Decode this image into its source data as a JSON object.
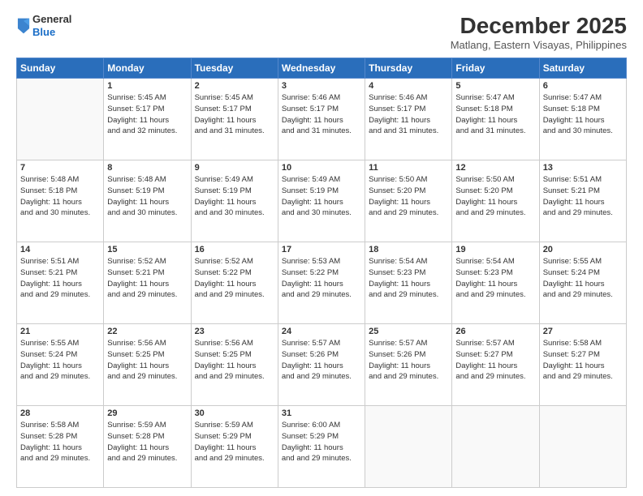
{
  "header": {
    "logo_general": "General",
    "logo_blue": "Blue",
    "month_title": "December 2025",
    "location": "Matlang, Eastern Visayas, Philippines"
  },
  "weekdays": [
    "Sunday",
    "Monday",
    "Tuesday",
    "Wednesday",
    "Thursday",
    "Friday",
    "Saturday"
  ],
  "weeks": [
    [
      {
        "day": "",
        "sunrise": "",
        "sunset": "",
        "daylight": ""
      },
      {
        "day": "1",
        "sunrise": "Sunrise: 5:45 AM",
        "sunset": "Sunset: 5:17 PM",
        "daylight": "Daylight: 11 hours and 32 minutes."
      },
      {
        "day": "2",
        "sunrise": "Sunrise: 5:45 AM",
        "sunset": "Sunset: 5:17 PM",
        "daylight": "Daylight: 11 hours and 31 minutes."
      },
      {
        "day": "3",
        "sunrise": "Sunrise: 5:46 AM",
        "sunset": "Sunset: 5:17 PM",
        "daylight": "Daylight: 11 hours and 31 minutes."
      },
      {
        "day": "4",
        "sunrise": "Sunrise: 5:46 AM",
        "sunset": "Sunset: 5:17 PM",
        "daylight": "Daylight: 11 hours and 31 minutes."
      },
      {
        "day": "5",
        "sunrise": "Sunrise: 5:47 AM",
        "sunset": "Sunset: 5:18 PM",
        "daylight": "Daylight: 11 hours and 31 minutes."
      },
      {
        "day": "6",
        "sunrise": "Sunrise: 5:47 AM",
        "sunset": "Sunset: 5:18 PM",
        "daylight": "Daylight: 11 hours and 30 minutes."
      }
    ],
    [
      {
        "day": "7",
        "sunrise": "Sunrise: 5:48 AM",
        "sunset": "Sunset: 5:18 PM",
        "daylight": "Daylight: 11 hours and 30 minutes."
      },
      {
        "day": "8",
        "sunrise": "Sunrise: 5:48 AM",
        "sunset": "Sunset: 5:19 PM",
        "daylight": "Daylight: 11 hours and 30 minutes."
      },
      {
        "day": "9",
        "sunrise": "Sunrise: 5:49 AM",
        "sunset": "Sunset: 5:19 PM",
        "daylight": "Daylight: 11 hours and 30 minutes."
      },
      {
        "day": "10",
        "sunrise": "Sunrise: 5:49 AM",
        "sunset": "Sunset: 5:19 PM",
        "daylight": "Daylight: 11 hours and 30 minutes."
      },
      {
        "day": "11",
        "sunrise": "Sunrise: 5:50 AM",
        "sunset": "Sunset: 5:20 PM",
        "daylight": "Daylight: 11 hours and 29 minutes."
      },
      {
        "day": "12",
        "sunrise": "Sunrise: 5:50 AM",
        "sunset": "Sunset: 5:20 PM",
        "daylight": "Daylight: 11 hours and 29 minutes."
      },
      {
        "day": "13",
        "sunrise": "Sunrise: 5:51 AM",
        "sunset": "Sunset: 5:21 PM",
        "daylight": "Daylight: 11 hours and 29 minutes."
      }
    ],
    [
      {
        "day": "14",
        "sunrise": "Sunrise: 5:51 AM",
        "sunset": "Sunset: 5:21 PM",
        "daylight": "Daylight: 11 hours and 29 minutes."
      },
      {
        "day": "15",
        "sunrise": "Sunrise: 5:52 AM",
        "sunset": "Sunset: 5:21 PM",
        "daylight": "Daylight: 11 hours and 29 minutes."
      },
      {
        "day": "16",
        "sunrise": "Sunrise: 5:52 AM",
        "sunset": "Sunset: 5:22 PM",
        "daylight": "Daylight: 11 hours and 29 minutes."
      },
      {
        "day": "17",
        "sunrise": "Sunrise: 5:53 AM",
        "sunset": "Sunset: 5:22 PM",
        "daylight": "Daylight: 11 hours and 29 minutes."
      },
      {
        "day": "18",
        "sunrise": "Sunrise: 5:54 AM",
        "sunset": "Sunset: 5:23 PM",
        "daylight": "Daylight: 11 hours and 29 minutes."
      },
      {
        "day": "19",
        "sunrise": "Sunrise: 5:54 AM",
        "sunset": "Sunset: 5:23 PM",
        "daylight": "Daylight: 11 hours and 29 minutes."
      },
      {
        "day": "20",
        "sunrise": "Sunrise: 5:55 AM",
        "sunset": "Sunset: 5:24 PM",
        "daylight": "Daylight: 11 hours and 29 minutes."
      }
    ],
    [
      {
        "day": "21",
        "sunrise": "Sunrise: 5:55 AM",
        "sunset": "Sunset: 5:24 PM",
        "daylight": "Daylight: 11 hours and 29 minutes."
      },
      {
        "day": "22",
        "sunrise": "Sunrise: 5:56 AM",
        "sunset": "Sunset: 5:25 PM",
        "daylight": "Daylight: 11 hours and 29 minutes."
      },
      {
        "day": "23",
        "sunrise": "Sunrise: 5:56 AM",
        "sunset": "Sunset: 5:25 PM",
        "daylight": "Daylight: 11 hours and 29 minutes."
      },
      {
        "day": "24",
        "sunrise": "Sunrise: 5:57 AM",
        "sunset": "Sunset: 5:26 PM",
        "daylight": "Daylight: 11 hours and 29 minutes."
      },
      {
        "day": "25",
        "sunrise": "Sunrise: 5:57 AM",
        "sunset": "Sunset: 5:26 PM",
        "daylight": "Daylight: 11 hours and 29 minutes."
      },
      {
        "day": "26",
        "sunrise": "Sunrise: 5:57 AM",
        "sunset": "Sunset: 5:27 PM",
        "daylight": "Daylight: 11 hours and 29 minutes."
      },
      {
        "day": "27",
        "sunrise": "Sunrise: 5:58 AM",
        "sunset": "Sunset: 5:27 PM",
        "daylight": "Daylight: 11 hours and 29 minutes."
      }
    ],
    [
      {
        "day": "28",
        "sunrise": "Sunrise: 5:58 AM",
        "sunset": "Sunset: 5:28 PM",
        "daylight": "Daylight: 11 hours and 29 minutes."
      },
      {
        "day": "29",
        "sunrise": "Sunrise: 5:59 AM",
        "sunset": "Sunset: 5:28 PM",
        "daylight": "Daylight: 11 hours and 29 minutes."
      },
      {
        "day": "30",
        "sunrise": "Sunrise: 5:59 AM",
        "sunset": "Sunset: 5:29 PM",
        "daylight": "Daylight: 11 hours and 29 minutes."
      },
      {
        "day": "31",
        "sunrise": "Sunrise: 6:00 AM",
        "sunset": "Sunset: 5:29 PM",
        "daylight": "Daylight: 11 hours and 29 minutes."
      },
      {
        "day": "",
        "sunrise": "",
        "sunset": "",
        "daylight": ""
      },
      {
        "day": "",
        "sunrise": "",
        "sunset": "",
        "daylight": ""
      },
      {
        "day": "",
        "sunrise": "",
        "sunset": "",
        "daylight": ""
      }
    ]
  ]
}
